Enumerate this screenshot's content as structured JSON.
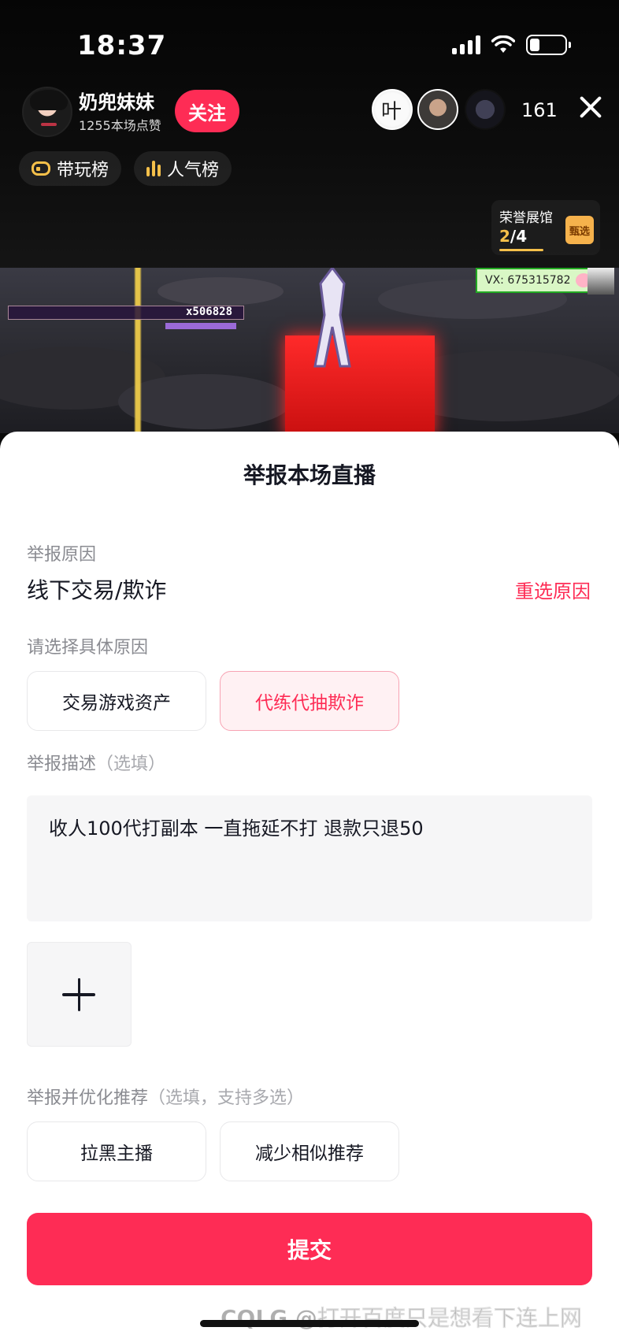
{
  "status_bar": {
    "time": "18:37",
    "battery_level": 0.2
  },
  "live_header": {
    "host_name": "奶兜妹妹",
    "likes_text": "1255本场点赞",
    "follow_label": "关注",
    "viewer_count": "161",
    "viewer_avatar_1_text": "叶",
    "rank_tabs": [
      {
        "label": "带玩榜",
        "icon": "gamepad-icon"
      },
      {
        "label": "人气榜",
        "icon": "bar-chart-icon"
      }
    ],
    "honor_hall": {
      "title": "荣誉展馆",
      "current": "2",
      "total": "/4",
      "gift_text": "甄选"
    }
  },
  "stream": {
    "hud_score": "x506828",
    "vx_tag": "VX: 675315782"
  },
  "report": {
    "title": "举报本场直播",
    "reason_label": "举报原因",
    "reason_value": "线下交易/欺诈",
    "reselect_label": "重选原因",
    "specific_label": "请选择具体原因",
    "specific_options": [
      {
        "label": "交易游戏资产",
        "selected": false
      },
      {
        "label": "代练代抽欺诈",
        "selected": true
      }
    ],
    "desc_label": "举报描述",
    "desc_hint": "（选填）",
    "desc_text": "收人100代打副本 一直拖延不打 退款只退50",
    "optimize_label": "举报并优化推荐",
    "optimize_hint": "（选填，支持多选）",
    "optimize_options": [
      {
        "label": "拉黑主播"
      },
      {
        "label": "减少相似推荐"
      }
    ],
    "submit_label": "提交"
  },
  "watermark": "CQLG @打开百度只是想看下连上网",
  "colors": {
    "accent": "#fe2c55",
    "selected_bg": "#fff1f3",
    "gold": "#f5c04a"
  }
}
